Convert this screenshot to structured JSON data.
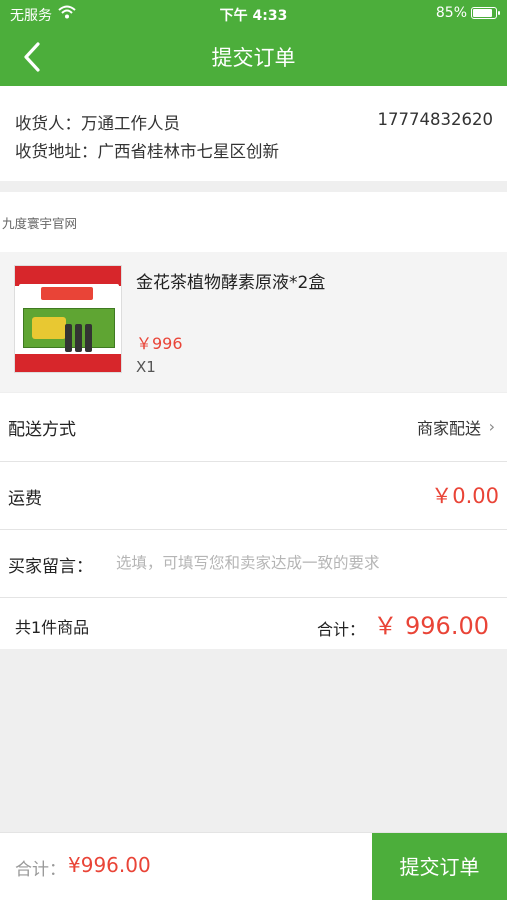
{
  "status_bar": {
    "carrier": "无服务",
    "time": "下午 4:33",
    "battery": "85%",
    "battery_level": 0.85
  },
  "nav": {
    "title": "提交订单",
    "back_icon": "chevron-left-icon"
  },
  "address": {
    "receiver": "收货人：万通工作人员",
    "phone": "17774832620",
    "address": "收货地址：广西省桂林市七星区创新"
  },
  "shop": {
    "name": "九度寰宇官网"
  },
  "product": {
    "name": "金花茶植物酵素原液*2盒",
    "price": "￥996",
    "quantity": "X1"
  },
  "delivery": {
    "label": "配送方式",
    "value": "商家配送",
    "chevron": "›"
  },
  "shipping": {
    "label": "运费",
    "value": "￥0.00"
  },
  "message": {
    "label": "买家留言：",
    "placeholder": "选填，可填写您和卖家达成一致的要求"
  },
  "summary": {
    "count": "共1件商品",
    "total_label": "合计：",
    "total_value": "￥ 996.00"
  },
  "bottom": {
    "sum_label": "合计：",
    "sum_value": "¥996.00",
    "submit_label": "提交订单"
  },
  "colors": {
    "brand_green": "#4cae3b",
    "price_red": "#e94437"
  }
}
